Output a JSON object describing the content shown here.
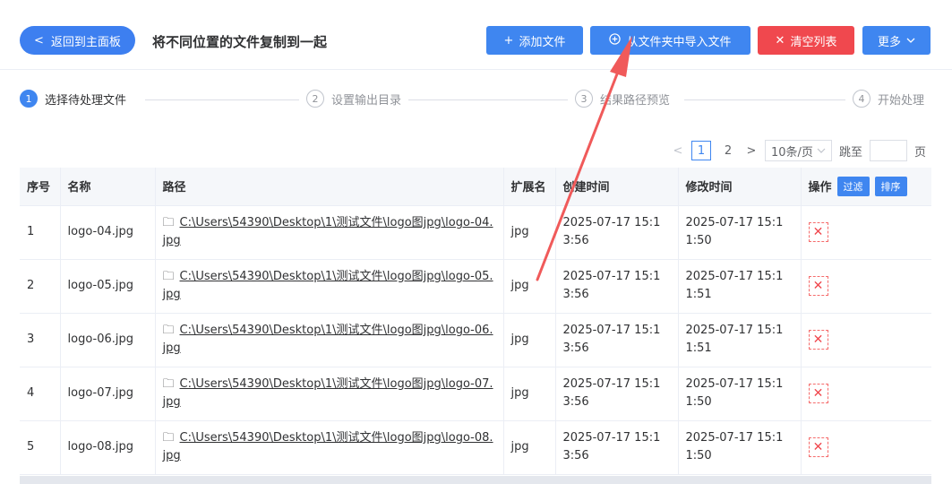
{
  "header": {
    "back_label": "返回到主面板",
    "back_icon": "<",
    "title": "将不同位置的文件复制到一起",
    "add_file_label": "添加文件",
    "import_folder_label": "从文件夹中导入文件",
    "clear_label": "清空列表",
    "more_label": "更多"
  },
  "steps": [
    {
      "num": "1",
      "label": "选择待处理文件"
    },
    {
      "num": "2",
      "label": "设置输出目录"
    },
    {
      "num": "3",
      "label": "结果路径预览"
    },
    {
      "num": "4",
      "label": "开始处理"
    }
  ],
  "pager": {
    "prev": "<",
    "next": ">",
    "pages": [
      "1",
      "2"
    ],
    "page_size": "10条/页",
    "jump_label": "跳至",
    "page_suffix": "页"
  },
  "table": {
    "headers": {
      "index": "序号",
      "name": "名称",
      "path": "路径",
      "ext": "扩展名",
      "created": "创建时间",
      "modified": "修改时间",
      "actions": "操作",
      "filter": "过滤",
      "sort": "排序"
    },
    "rows": [
      {
        "index": "1",
        "name": "logo-04.jpg",
        "path": "C:\\Users\\54390\\Desktop\\1\\测试文件\\logo图jpg\\logo-04.jpg",
        "ext": "jpg",
        "created": "2025-07-17 15:13:56",
        "modified": "2025-07-17 15:11:50"
      },
      {
        "index": "2",
        "name": "logo-05.jpg",
        "path": "C:\\Users\\54390\\Desktop\\1\\测试文件\\logo图jpg\\logo-05.jpg",
        "ext": "jpg",
        "created": "2025-07-17 15:13:56",
        "modified": "2025-07-17 15:11:51"
      },
      {
        "index": "3",
        "name": "logo-06.jpg",
        "path": "C:\\Users\\54390\\Desktop\\1\\测试文件\\logo图jpg\\logo-06.jpg",
        "ext": "jpg",
        "created": "2025-07-17 15:13:56",
        "modified": "2025-07-17 15:11:51"
      },
      {
        "index": "4",
        "name": "logo-07.jpg",
        "path": "C:\\Users\\54390\\Desktop\\1\\测试文件\\logo图jpg\\logo-07.jpg",
        "ext": "jpg",
        "created": "2025-07-17 15:13:56",
        "modified": "2025-07-17 15:11:50"
      },
      {
        "index": "5",
        "name": "logo-08.jpg",
        "path": "C:\\Users\\54390\\Desktop\\1\\测试文件\\logo图jpg\\logo-08.jpg",
        "ext": "jpg",
        "created": "2025-07-17 15:13:56",
        "modified": "2025-07-17 15:11:50"
      }
    ]
  },
  "colors": {
    "primary": "#3f86f0",
    "danger": "#f0484e",
    "annotation_arrow": "#f05a5a"
  }
}
